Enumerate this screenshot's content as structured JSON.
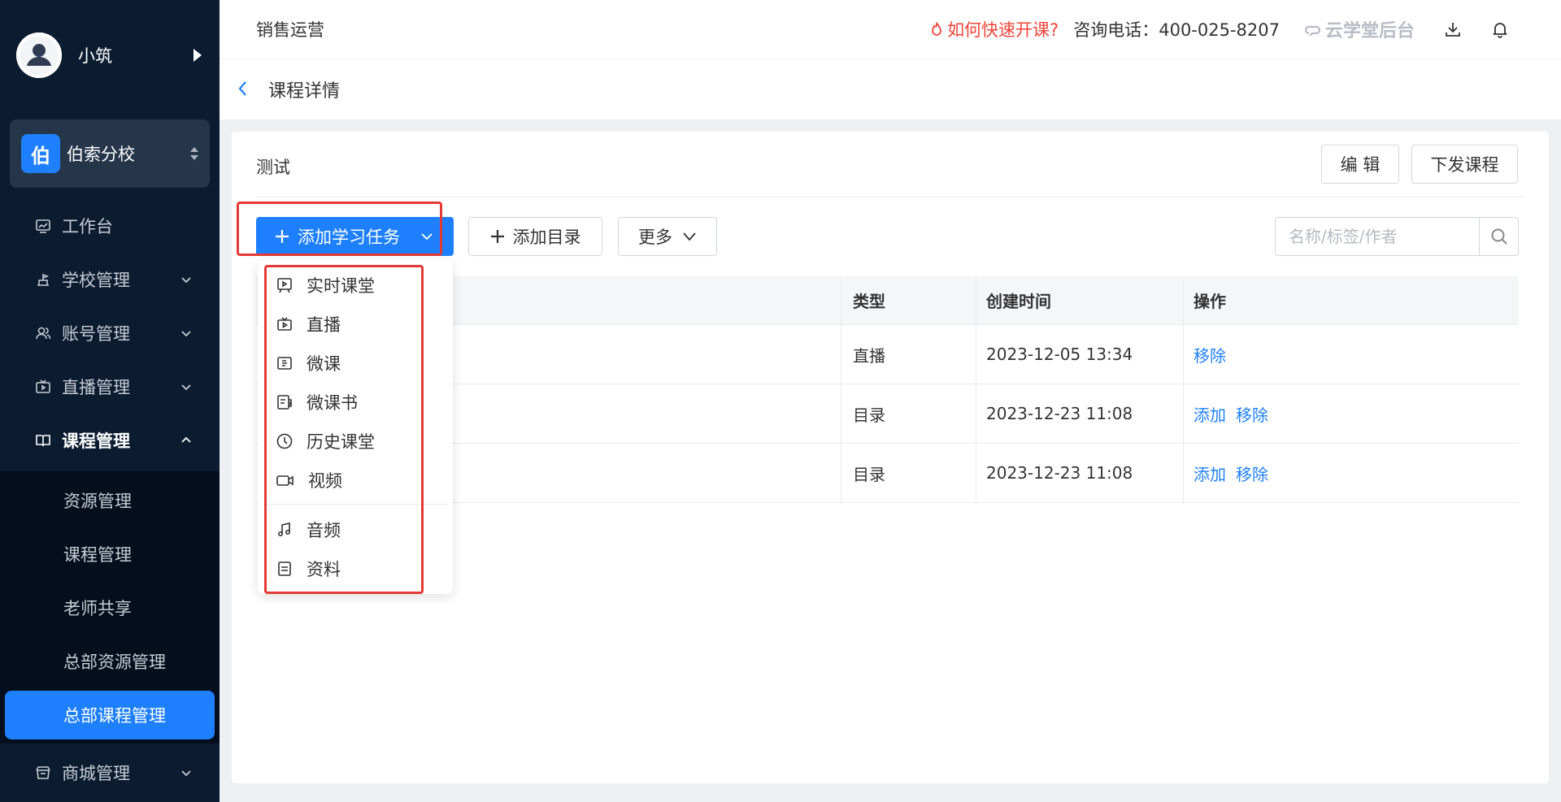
{
  "sidebar": {
    "user_name": "小筑",
    "school_badge": "伯",
    "school_name": "伯索分校",
    "nav": [
      {
        "label": "工作台",
        "icon": "dashboard-icon"
      },
      {
        "label": "学校管理",
        "icon": "school-icon"
      },
      {
        "label": "账号管理",
        "icon": "users-icon"
      },
      {
        "label": "直播管理",
        "icon": "live-icon"
      },
      {
        "label": "课程管理",
        "icon": "book-icon"
      }
    ],
    "submenu": [
      "资源管理",
      "课程管理",
      "老师共享",
      "总部资源管理",
      "总部课程管理"
    ],
    "mall": {
      "label": "商城管理",
      "icon": "shop-icon"
    }
  },
  "header": {
    "title": "销售运营",
    "help": "如何快速开课?",
    "phone": "咨询电话：400-025-8207",
    "brand": "云学堂后台"
  },
  "breadcrumb": {
    "title": "课程详情"
  },
  "course": {
    "name": "测试",
    "edit_label": "编 辑",
    "distribute_label": "下发课程"
  },
  "toolbar": {
    "add_task": "添加学习任务",
    "add_dir": "添加目录",
    "more": "更多",
    "search_placeholder": "名称/标签/作者"
  },
  "table": {
    "headers": [
      "",
      "类型",
      "创建时间",
      "操作"
    ],
    "rows": [
      {
        "type": "直播",
        "time": "2023-12-05 13:34",
        "ops": [
          "移除"
        ]
      },
      {
        "type": "目录",
        "time": "2023-12-23 11:08",
        "ops": [
          "添加",
          "移除"
        ]
      },
      {
        "type": "目录",
        "time": "2023-12-23 11:08",
        "ops": [
          "添加",
          "移除"
        ]
      }
    ]
  },
  "dropdown": [
    {
      "label": "实时课堂",
      "icon": "classroom-icon"
    },
    {
      "label": "直播",
      "icon": "tv-icon"
    },
    {
      "label": "微课",
      "icon": "micro-course-icon"
    },
    {
      "label": "微课书",
      "icon": "micro-book-icon"
    },
    {
      "label": "历史课堂",
      "icon": "clock-icon"
    },
    {
      "label": "视频",
      "icon": "video-icon"
    },
    {
      "label": "音频",
      "icon": "music-icon"
    },
    {
      "label": "资料",
      "icon": "document-icon"
    }
  ],
  "colors": {
    "accent": "#1e80ff",
    "sidebar_bg": "#0c1c30",
    "highlight": "#e53935",
    "help_red": "#f0453a"
  }
}
